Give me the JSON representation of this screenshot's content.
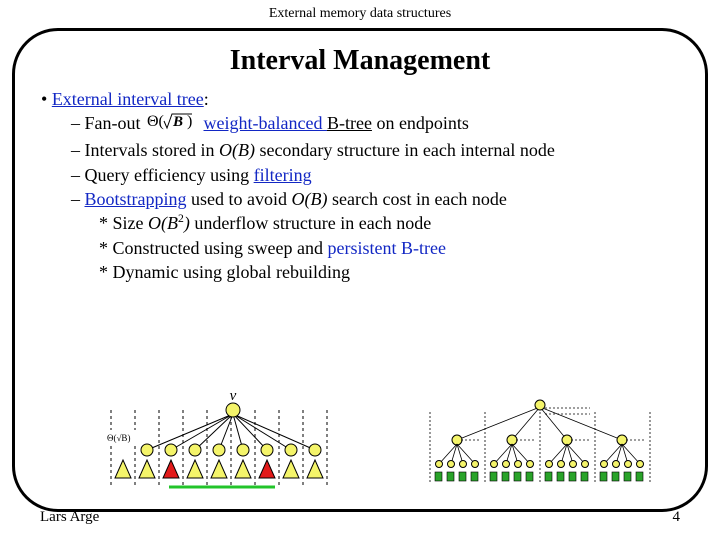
{
  "header": "External memory data structures",
  "title": "Interval Management",
  "bullets": {
    "b1": {
      "lead": "• ",
      "text": "External interval tree",
      "tail": ":"
    },
    "b2a": {
      "dash": "– ",
      "pre": "Fan-out ",
      "post1": " ",
      "link": "weight-balanced ",
      "post2": "B-tree",
      "tail": " on endpoints"
    },
    "b2b": {
      "dash": "– Intervals stored in ",
      "ital": "O(B)",
      "tail": " secondary structure in each internal node"
    },
    "b2c": {
      "dash": "– Query efficiency using ",
      "link": "filtering"
    },
    "b2d": {
      "dash": "– ",
      "link": "Bootstrapping",
      "mid": " used to avoid ",
      "ital": "O(B)",
      "tail": " search cost in each node"
    },
    "b3a": {
      "star": "* Size ",
      "ital1": "O(B",
      "sup": "2",
      "ital2": ")",
      "tail": " underflow structure in each node"
    },
    "b3b": {
      "star": "* Constructed using sweep and ",
      "plain1": "persistent",
      "plain2": " B-tree"
    },
    "b3c": {
      "star": "* Dynamic using global rebuilding"
    }
  },
  "diagram": {
    "v_label": "v",
    "theta_label": "Θ(√B)"
  },
  "footer": {
    "left": "Lars Arge",
    "right": "4"
  }
}
